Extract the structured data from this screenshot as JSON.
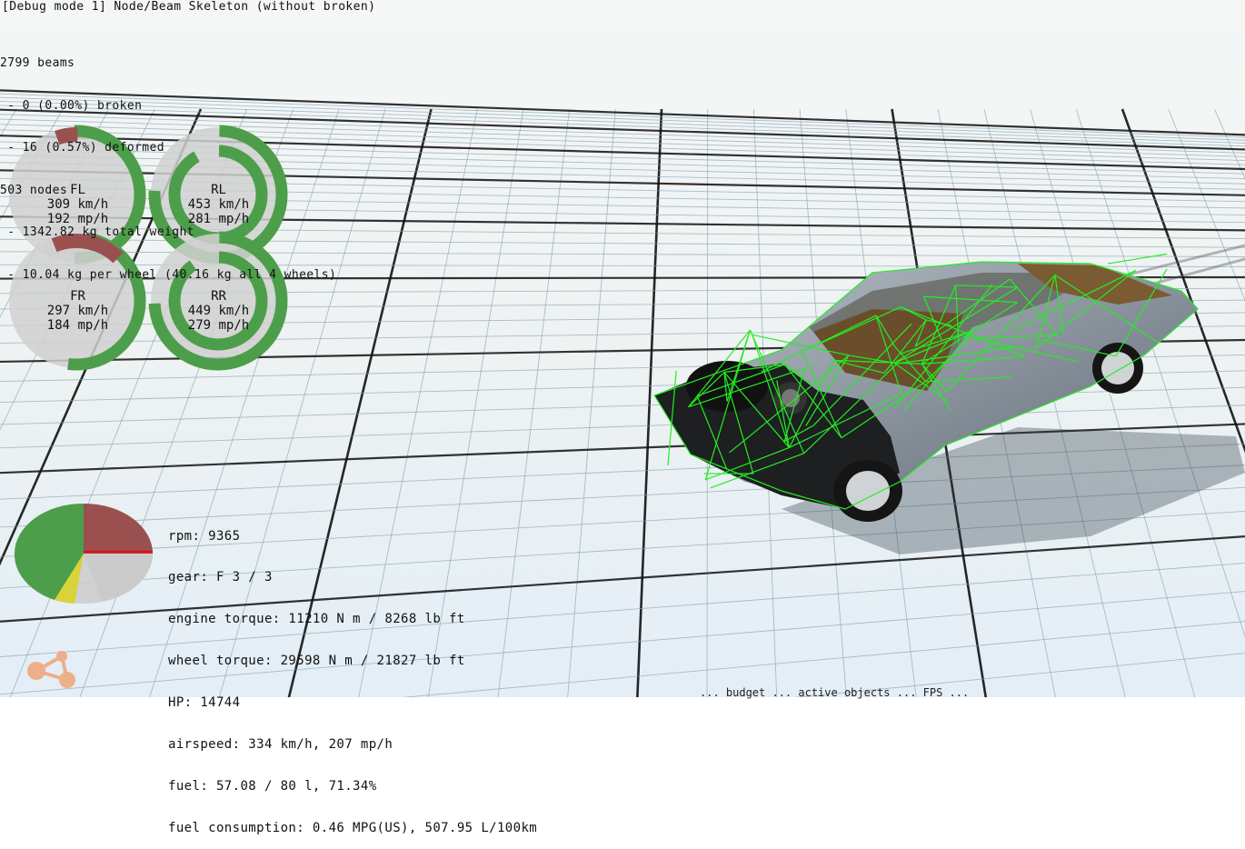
{
  "debug": {
    "title": "[Debug mode 1] Node/Beam Skeleton (without broken)",
    "stats": [
      "2799 beams",
      " - 0 (0.00%) broken",
      " - 16 (0.57%) deformed",
      "503 nodes",
      " - 1342.82 kg total weight",
      " - 10.04 kg per wheel (40.16 kg all 4 wheels)"
    ]
  },
  "wheels": [
    {
      "id": "FL",
      "kmh": "309 km/h",
      "mph": "192 mp/h"
    },
    {
      "id": "RL",
      "kmh": "453 km/h",
      "mph": "281 mp/h"
    },
    {
      "id": "FR",
      "kmh": "297 km/h",
      "mph": "184 mp/h"
    },
    {
      "id": "RR",
      "kmh": "449 km/h",
      "mph": "279 mp/h"
    }
  ],
  "engine": {
    "rpm": "rpm: 9365",
    "gear": "gear: F 3 / 3",
    "engine_torque": "engine torque: 11210 N m / 8268 lb ft",
    "wheel_torque": "wheel torque: 29598 N m / 21827 lb ft",
    "hp": "HP: 14744",
    "airspeed": "airspeed: 334 km/h, 207 mp/h",
    "fuel": "fuel: 57.08 / 80 l, 71.34%",
    "fuel_consumption": "fuel consumption: 0.46 MPG(US), 507.95 L/100km"
  },
  "status_bar": "... budget ... active objects ... FPS ... "
}
